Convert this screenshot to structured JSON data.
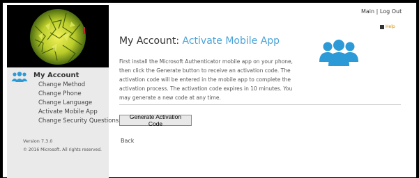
{
  "header": {
    "main_link": "Main",
    "separator": "|",
    "logout_link": "Log Out",
    "help_label": "Help"
  },
  "sidebar": {
    "title": "My Account",
    "items": [
      {
        "label": "Change Method"
      },
      {
        "label": "Change Phone"
      },
      {
        "label": "Change Language"
      },
      {
        "label": "Activate Mobile App"
      },
      {
        "label": "Change Security Questions"
      }
    ],
    "version": "Version 7.3.0",
    "copyright": "© 2016 Microsoft. All rights reserved."
  },
  "main": {
    "title_prefix": "My Account:",
    "title_suffix": "Activate Mobile App",
    "description": "First install the Microsoft Authenticator mobile app on your phone, then click the Generate button to receive an activation code. The activation code will be entered in the mobile app to complete the activation process. The activation code expires in 10 minutes. You may generate a new code at any time.",
    "generate_button": "Generate Activation Code",
    "back_link": "Back"
  },
  "colors": {
    "accent_blue": "#4ba3d8",
    "sidebar_bg": "#eaeaea",
    "help_orange": "#d48a00"
  },
  "icons": {
    "sidebar_icon": "people-icon",
    "main_icon": "people-icon",
    "help_icon": "help-icon"
  }
}
